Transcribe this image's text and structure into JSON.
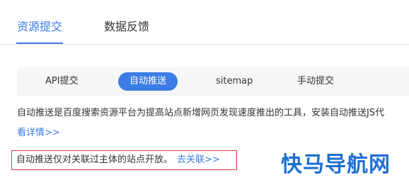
{
  "top_tabs": {
    "active_label": "资源提交",
    "inactive_label": "数据反馈"
  },
  "sub_tabs": {
    "api": "API提交",
    "auto": "自动推送",
    "sitemap": "sitemap",
    "manual": "手动提交"
  },
  "description": {
    "text": "自动推送是百度搜索资源平台为提高站点新增网页发现速度推出的工具，安装自动推送JS代",
    "more_link": "看详情>>"
  },
  "notice": {
    "text": "自动推送仅对关联过主体的站点开放。",
    "link": "去关联>>"
  },
  "watermark": {
    "text": "快马导航网"
  },
  "colors": {
    "accent": "#3c7de6",
    "notice_border": "#e03a3a",
    "watermark": "#1f6fd1"
  }
}
